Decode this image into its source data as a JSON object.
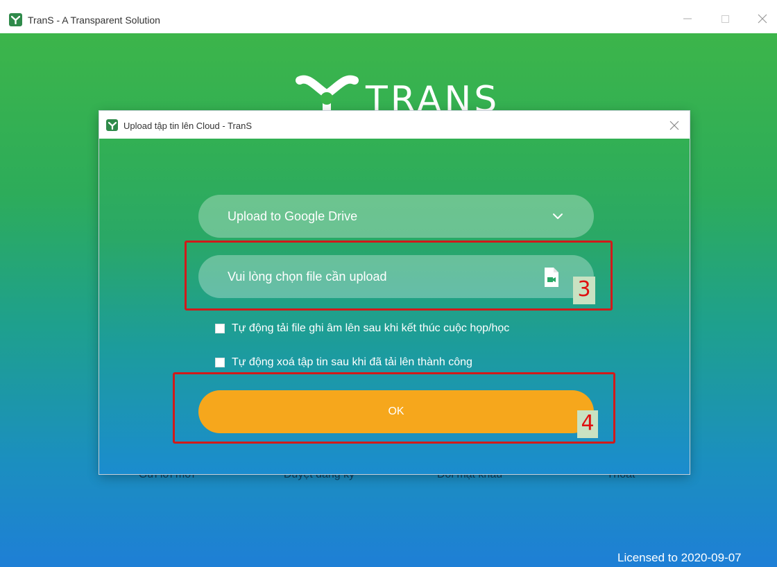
{
  "window": {
    "title": "TranS - A Transparent Solution",
    "controls": [
      "minimize",
      "maximize",
      "close"
    ]
  },
  "main": {
    "brand_text": "TRANS",
    "menu": [
      {
        "label": "Gửi lời mời"
      },
      {
        "label": "Duyệt đăng ký"
      },
      {
        "label": "Đổi mật khẩu"
      },
      {
        "label": "Thoát"
      }
    ],
    "license": "Licensed to 2020-09-07"
  },
  "dialog": {
    "title": "Upload tập tin lên Cloud - TranS",
    "destination_select": {
      "value": "Upload to Google Drive",
      "icon": "chevron-down-icon"
    },
    "file_picker": {
      "placeholder": "Vui lòng chọn file cần upload",
      "icon": "file-video-icon"
    },
    "checkboxes": [
      {
        "label": "Tự động tải file ghi âm lên sau khi kết thúc cuộc họp/học",
        "checked": false
      },
      {
        "label": "Tự động xoá tập tin sau khi đã tải lên thành công",
        "checked": false
      }
    ],
    "ok_label": "OK"
  },
  "annotations": [
    {
      "number": "3"
    },
    {
      "number": "4"
    }
  ],
  "colors": {
    "accent_green": "#3cb54a",
    "accent_blue": "#1e7fd6",
    "ok_orange": "#f6a71c",
    "annotation_red": "#d11a1a"
  }
}
